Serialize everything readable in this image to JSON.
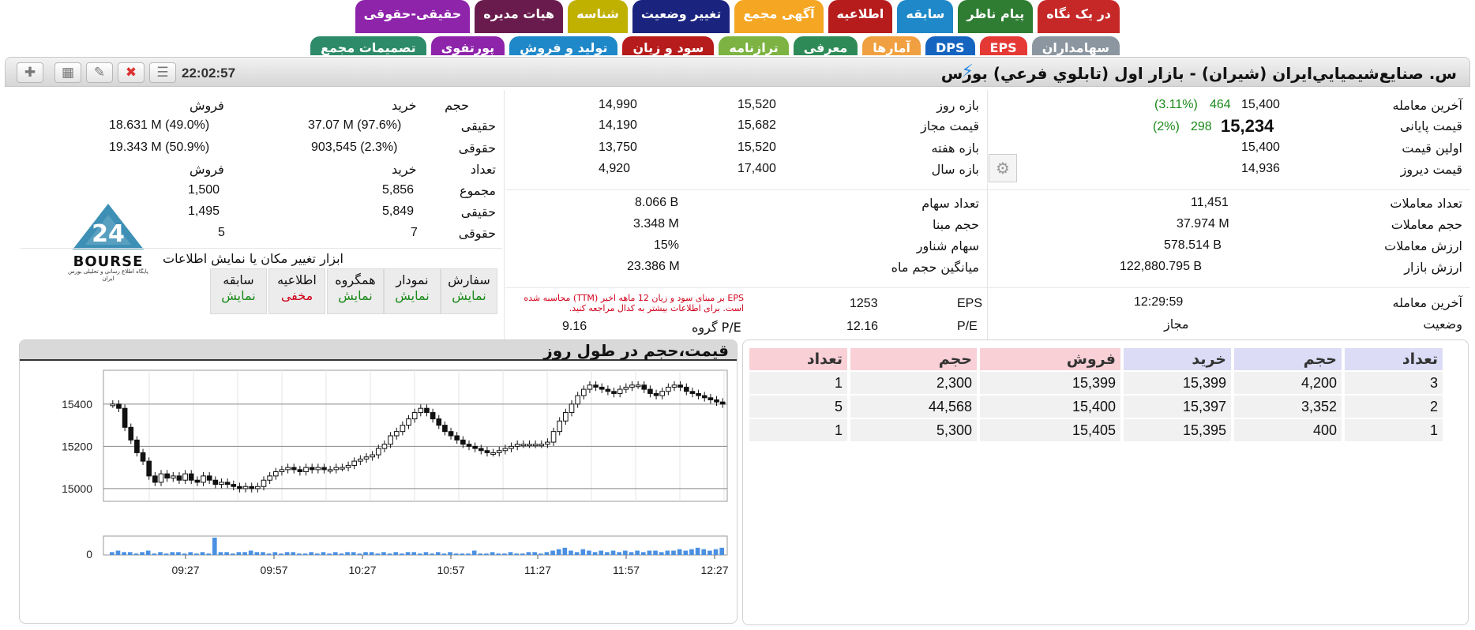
{
  "tabs_row1": [
    {
      "label": "در یک نگاه",
      "color": "#c62828"
    },
    {
      "label": "پیام ناظر",
      "color": "#2e7d32"
    },
    {
      "label": "سابقه",
      "color": "#1e88c8"
    },
    {
      "label": "اطلاعیه",
      "color": "#b71c1c"
    },
    {
      "label": "آگهی مجمع",
      "color": "#f5a623"
    },
    {
      "label": "تغییر وضعیت",
      "color": "#1a237e"
    },
    {
      "label": "شناسه",
      "color": "#c0b000"
    },
    {
      "label": "هیات مدیره",
      "color": "#6a1b4d"
    },
    {
      "label": "حقیقی-حقوقی",
      "color": "#8e24aa"
    }
  ],
  "tabs_row2": [
    {
      "label": "سهامداران",
      "color": "#8c96a0"
    },
    {
      "label": "EPS",
      "color": "#e53935"
    },
    {
      "label": "DPS",
      "color": "#1565c0"
    },
    {
      "label": "آمارها",
      "color": "#f0a040"
    },
    {
      "label": "معرفی",
      "color": "#2e8b57"
    },
    {
      "label": "ترازنامه",
      "color": "#7cb342"
    },
    {
      "label": "سود و زیان",
      "color": "#b71c1c"
    },
    {
      "label": "تولید و فروش",
      "color": "#1e88c8"
    },
    {
      "label": "پورتفوی",
      "color": "#8e24aa"
    },
    {
      "label": "تصمیمات مجمع",
      "color": "#2e8b6a"
    }
  ],
  "header": {
    "title": "س. صنايع‌شيميايي‌ايران (شيران) - بازار اول (تابلوي فرعي) بورس",
    "time": "22:02:57"
  },
  "price": {
    "last_trade_label": "آخرین معامله",
    "last_trade": "15,400",
    "last_change": "464",
    "last_change_pct": "(3.11%)",
    "close_label": "قیمت پایانی",
    "close": "15,234",
    "close_change": "298",
    "close_change_pct": "(2%)",
    "open_label": "اولین قیمت",
    "open": "15,400",
    "prev_label": "قیمت دیروز",
    "prev": "14,936"
  },
  "ranges": {
    "day_label": "بازه روز",
    "day_low": "14,990",
    "day_high": "15,520",
    "allowed_label": "قیمت مجاز",
    "allowed_low": "14,190",
    "allowed_high": "15,682",
    "week_label": "بازه هفته",
    "week_low": "13,750",
    "week_high": "15,520",
    "year_label": "بازه سال",
    "year_low": "4,920",
    "year_high": "17,400"
  },
  "stats_left": {
    "count_label": "تعداد معاملات",
    "count": "11,451",
    "volume_label": "حجم معاملات",
    "volume": "37.974 M",
    "value_label": "ارزش معاملات",
    "value": "578.514 B",
    "mcap_label": "ارزش بازار",
    "mcap": "122,880.795 B"
  },
  "stats_mid": {
    "shares_label": "تعداد سهام",
    "shares": "8.066 B",
    "base_label": "حجم مبنا",
    "base": "3.348 M",
    "float_label": "سهام شناور",
    "float": "15%",
    "avg_label": "میانگین حجم ماه",
    "avg": "23.386 M"
  },
  "status": {
    "last_label": "آخرین معامله",
    "last_time": "12:29:59",
    "state_label": "وضعیت",
    "state": "مجاز",
    "eps_label": "EPS",
    "eps": "1253",
    "pe_label": "P/E",
    "pe": "12.16",
    "group_pe_label": "P/E گروه",
    "group_pe": "9.16",
    "eps_note": "EPS بر مبنای سود و زیان 12 ماهه اخیر (TTM) محاسبه شده است. برای اطلاعات بیشتر به کدال مراجعه کنید."
  },
  "client_types": {
    "h_volume": "حجم",
    "h_buy": "خرید",
    "h_sell": "فروش",
    "real_label": "حقیقی",
    "real_buy": "37.07 M (97.6%)",
    "real_sell": "18.631 M (49.0%)",
    "legal_label": "حقوقی",
    "legal_buy": "903,545 (2.3%)",
    "legal_sell": "19.343 M (50.9%)",
    "h_count": "تعداد",
    "h_buy2": "خرید",
    "h_sell2": "فروش",
    "total_label": "مجموع",
    "total_buy": "5,856",
    "total_sell": "1,500",
    "real2_label": "حقیقی",
    "real2_buy": "5,849",
    "real2_sell": "1,495",
    "legal2_label": "حقوقی",
    "legal2_buy": "7",
    "legal2_sell": "5"
  },
  "logo": {
    "text": "BOURSE",
    "subtext": "پایگاه اطلاع رسانی و تحلیلی بورس ایران"
  },
  "tools": {
    "caption": "ابزار تغییر مکان یا نمایش اطلاعات",
    "buttons": [
      {
        "title": "سفارش",
        "state": "نمایش",
        "red": false
      },
      {
        "title": "نمودار",
        "state": "نمایش",
        "red": false
      },
      {
        "title": "همگروه",
        "state": "نمایش",
        "red": false
      },
      {
        "title": "اطلاعیه",
        "state": "مخفی",
        "red": true
      },
      {
        "title": "سابقه",
        "state": "نمایش",
        "red": false
      }
    ]
  },
  "chart_title": "قیمت،حجم در طول روز",
  "order_book": {
    "headers": [
      "تعداد",
      "حجم",
      "خرید",
      "فروش",
      "حجم",
      "تعداد"
    ],
    "rows": [
      [
        "3",
        "4,200",
        "15,399",
        "15,399",
        "2,300",
        "1"
      ],
      [
        "2",
        "3,352",
        "15,397",
        "15,400",
        "44,568",
        "5"
      ],
      [
        "1",
        "400",
        "15,395",
        "15,405",
        "5,300",
        "1"
      ]
    ]
  },
  "chart_data": {
    "type": "candlestick",
    "title": "",
    "y_ticks": [
      15000,
      15200,
      15400
    ],
    "ylim": [
      14940,
      15560
    ],
    "x_ticks": [
      "09:27",
      "09:57",
      "10:27",
      "10:57",
      "11:27",
      "11:57",
      "12:27"
    ],
    "x_range": [
      "09:03",
      "12:30"
    ],
    "volume_tick": "0",
    "price_points": [
      15400,
      15380,
      15290,
      15230,
      15170,
      15130,
      15060,
      15030,
      15070,
      15050,
      15060,
      15040,
      15070,
      15040,
      15030,
      15060,
      15040,
      15020,
      15030,
      15020,
      15010,
      15000,
      15010,
      15000,
      15010,
      15040,
      15060,
      15080,
      15090,
      15100,
      15090,
      15080,
      15100,
      15090,
      15100,
      15090,
      15090,
      15100,
      15100,
      15110,
      15130,
      15140,
      15150,
      15160,
      15190,
      15210,
      15250,
      15270,
      15300,
      15330,
      15360,
      15380,
      15360,
      15330,
      15300,
      15270,
      15250,
      15230,
      15210,
      15200,
      15190,
      15180,
      15170,
      15170,
      15180,
      15190,
      15200,
      15210,
      15210,
      15210,
      15210,
      15210,
      15220,
      15270,
      15320,
      15360,
      15400,
      15440,
      15470,
      15490,
      15480,
      15470,
      15460,
      15450,
      15470,
      15480,
      15490,
      15490,
      15470,
      15450,
      15440,
      15460,
      15480,
      15490,
      15480,
      15460,
      15450,
      15440,
      15430,
      15420,
      15410,
      15400
    ],
    "volume_points": [
      2,
      3,
      2,
      2,
      1,
      2,
      3,
      1,
      2,
      1,
      2,
      2,
      1,
      2,
      1,
      2,
      1,
      12,
      2,
      2,
      1,
      2,
      2,
      3,
      2,
      2,
      1,
      2,
      1,
      2,
      2,
      1,
      1,
      2,
      1,
      2,
      1,
      2,
      1,
      2,
      2,
      1,
      2,
      2,
      1,
      2,
      1,
      2,
      1,
      2,
      2,
      1,
      2,
      1,
      2,
      1,
      2,
      1,
      1,
      1,
      3,
      1,
      1,
      2,
      1,
      1,
      2,
      1,
      1,
      2,
      2,
      1,
      2,
      3,
      4,
      5,
      3,
      2,
      4,
      3,
      2,
      3,
      2,
      3,
      2,
      3,
      2,
      3,
      2,
      3,
      3,
      2,
      3,
      3,
      4,
      3,
      4,
      5,
      4,
      3,
      4,
      5
    ]
  }
}
